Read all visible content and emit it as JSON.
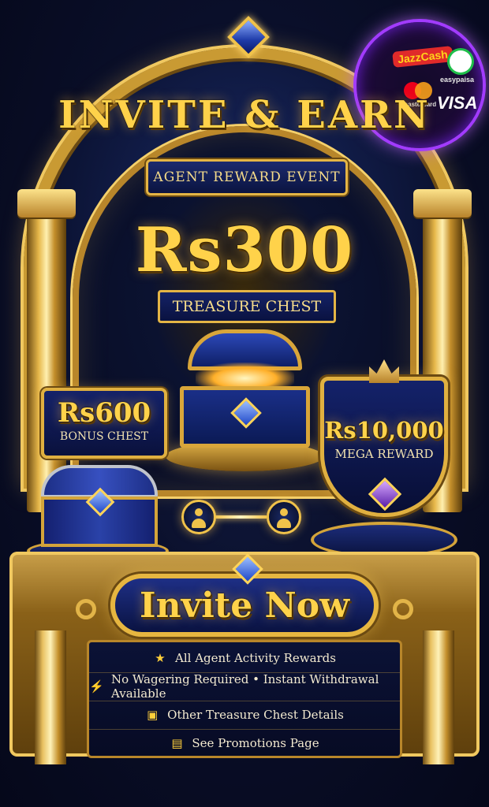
{
  "title": "INVITE & EARN",
  "subtitle": "AGENT REWARD EVENT",
  "main_reward": {
    "amount": "Rs300",
    "label": "TREASURE CHEST"
  },
  "bonus_reward": {
    "amount": "Rs600",
    "label": "BONUS CHEST"
  },
  "mega_reward": {
    "amount": "Rs10,000",
    "label": "MEGA REWARD"
  },
  "cta_button": {
    "label": "Invite Now"
  },
  "info_items": [
    {
      "icon": "star-shield-icon",
      "text": "All Agent Activity Rewards"
    },
    {
      "icon": "lightning-icon",
      "text": "No Wagering Required • Instant Withdrawal Available"
    },
    {
      "icon": "chest-icon",
      "text": "Other Treasure Chest Details"
    },
    {
      "icon": "document-icon",
      "text": "See Promotions Page"
    }
  ],
  "payment_methods": {
    "jazzcash": "JazzCash",
    "easypaisa": "easypaisa",
    "mastercard": "mastercard",
    "visa": "VISA"
  },
  "colors": {
    "gold": "#ffd24a",
    "navy": "#0a1342",
    "purple_glow": "#a23bff"
  }
}
